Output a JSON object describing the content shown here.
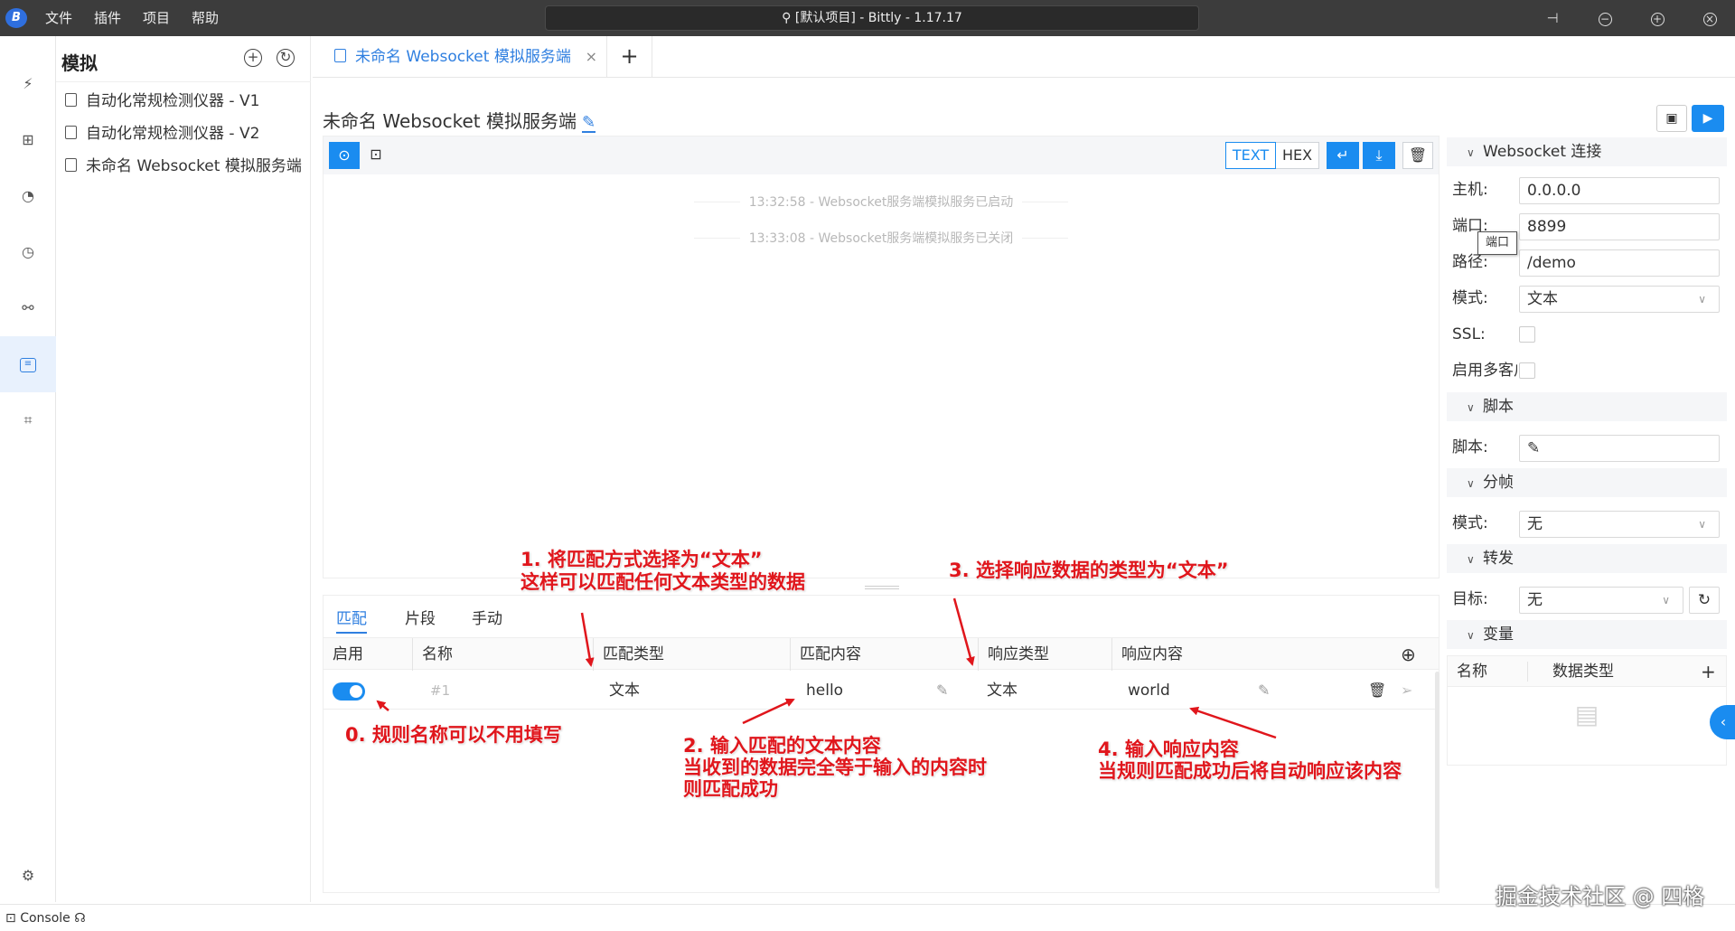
{
  "titlebar": {
    "logo": "B",
    "menu": [
      "文件",
      "插件",
      "项目",
      "帮助"
    ],
    "search_text": "[默认项目] - Bittly - 1.17.17"
  },
  "sidepanel": {
    "title": "模拟",
    "items": [
      "自动化常规检测仪器 - V1",
      "自动化常规检测仪器 - V2",
      "未命名 Websocket 模拟服务端"
    ]
  },
  "tab": {
    "label": "未命名 Websocket 模拟服务端",
    "close": "×",
    "add": "+"
  },
  "server": {
    "title": "未命名 Websocket 模拟服务端"
  },
  "toolbar": {
    "text_label": "TEXT",
    "hex_label": "HEX"
  },
  "messages": [
    "13:32:58 - Websocket服务端模拟服务已启动",
    "13:33:08 - Websocket服务端模拟服务已关闭"
  ],
  "rules": {
    "tabs": [
      "匹配",
      "片段",
      "手动"
    ],
    "columns": [
      "启用",
      "名称",
      "匹配类型",
      "匹配内容",
      "响应类型",
      "响应内容"
    ],
    "row": {
      "enabled": true,
      "name_placeholder": "#1",
      "match_type": "文本",
      "match_content": "hello",
      "response_type": "文本",
      "response_content": "world"
    }
  },
  "config": {
    "websocket": {
      "header": "Websocket 连接",
      "host_label": "主机:",
      "host": "0.0.0.0",
      "port_label": "端口:",
      "port": "8899",
      "port_tooltip": "端口",
      "path_label": "路径:",
      "path": "/demo",
      "mode_label": "模式:",
      "mode": "文本",
      "ssl_label": "SSL:",
      "multi_label": "启用多客户"
    },
    "script": {
      "header": "脚本",
      "label": "脚本:"
    },
    "frame": {
      "header": "分帧",
      "label": "模式:",
      "value": "无"
    },
    "forward": {
      "header": "转发",
      "label": "目标:",
      "value": "无"
    },
    "vars": {
      "header": "变量",
      "col_name": "名称",
      "col_type": "数据类型",
      "add": "+"
    }
  },
  "annotations": {
    "a0": "0. 规则名称可以不用填写",
    "a1_line1": "1. 将匹配方式选择为“文本”",
    "a1_line2": "这样可以匹配任何文本类型的数据",
    "a2_line1": "2. 输入匹配的文本内容",
    "a2_line2": "当收到的数据完全等于输入的内容时",
    "a2_line3": "则匹配成功",
    "a3": "3. 选择响应数据的类型为“文本”",
    "a4_line1": "4. 输入响应内容",
    "a4_line2": "当规则匹配成功后将自动响应该内容"
  },
  "statusbar": {
    "console": "Console"
  },
  "watermark": "掘金技术社区 @ 四格",
  "colors": {
    "accent": "#1a8cf0",
    "annotation": "#e0161c",
    "titlebar": "#3c3c3c"
  }
}
